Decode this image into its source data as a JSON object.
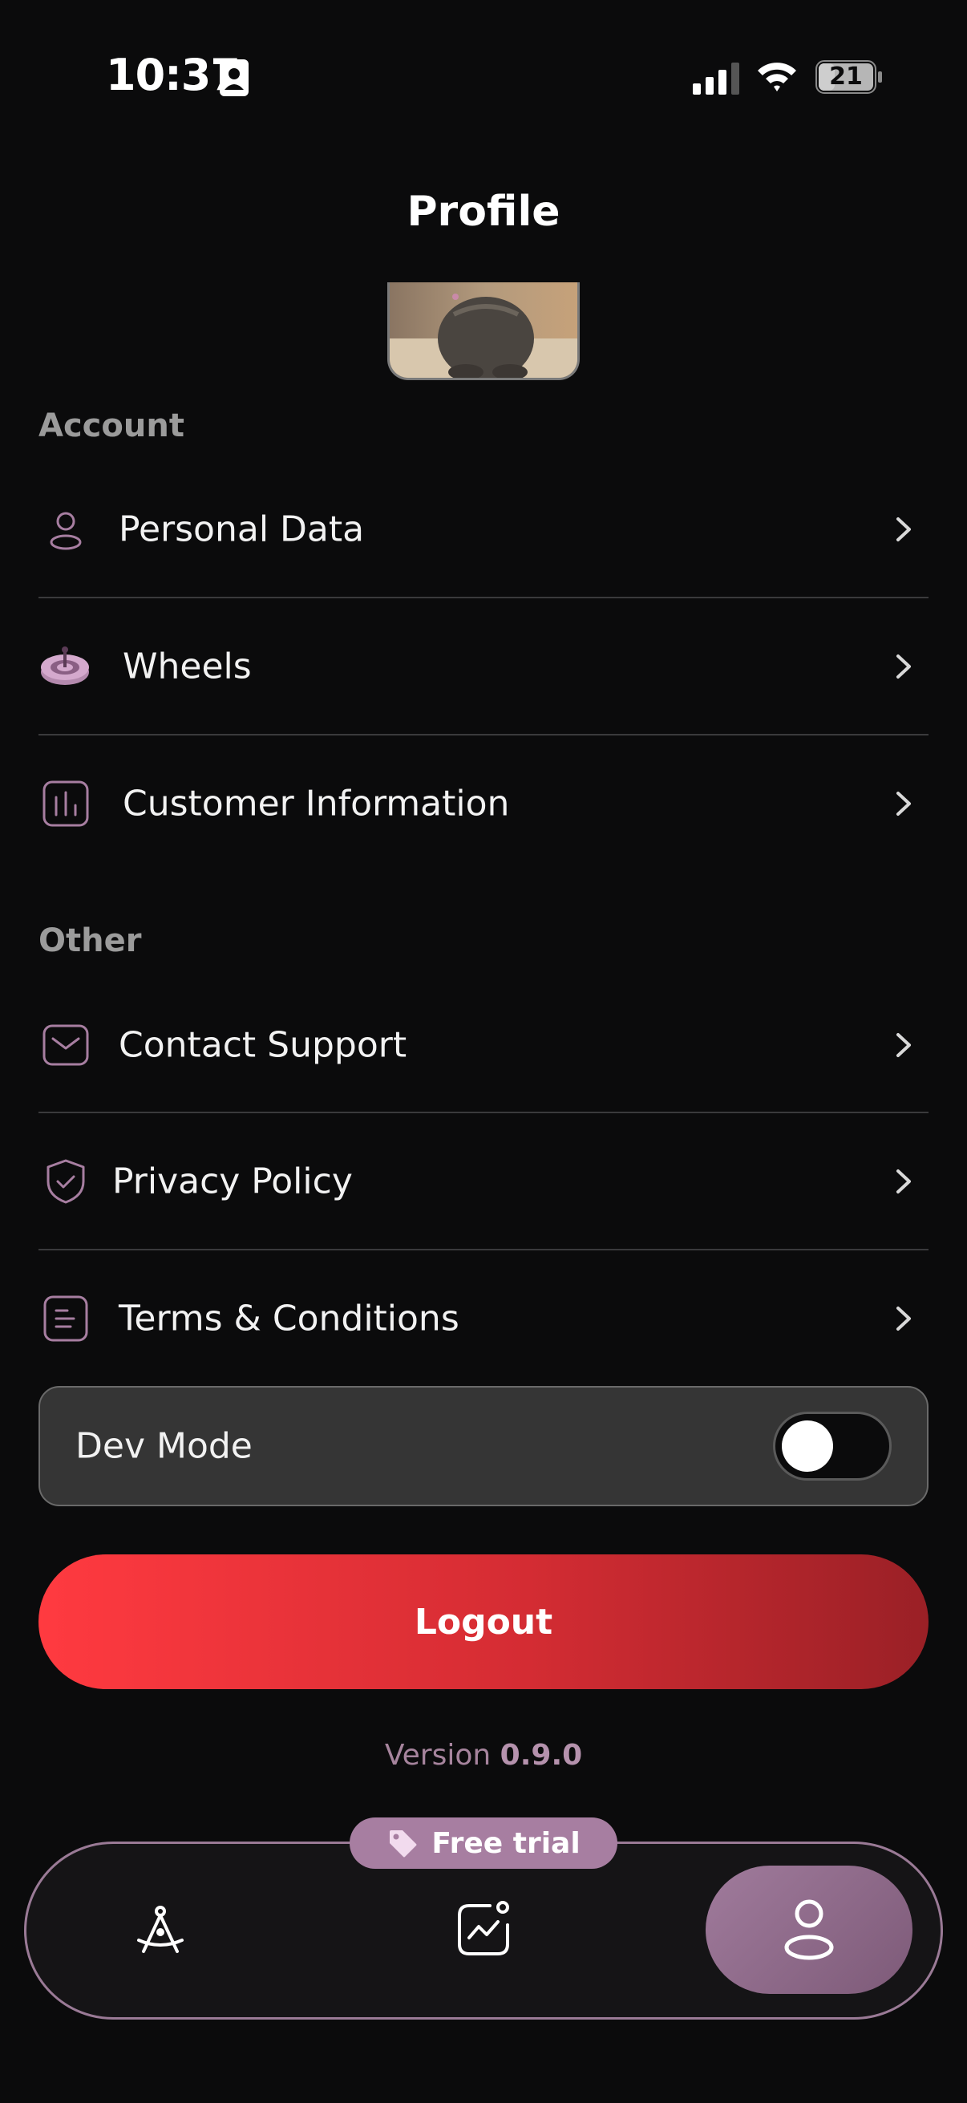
{
  "status_bar": {
    "time": "10:37",
    "battery": "21"
  },
  "header": {
    "title": "Profile"
  },
  "account": {
    "title": "Account",
    "items": [
      {
        "label": "Personal Data",
        "icon": "person-icon"
      },
      {
        "label": "Wheels",
        "icon": "wheel-icon"
      },
      {
        "label": "Customer Information",
        "icon": "bar-chart-icon"
      }
    ]
  },
  "other": {
    "title": "Other",
    "items": [
      {
        "label": "Contact Support",
        "icon": "mail-icon"
      },
      {
        "label": "Privacy Policy",
        "icon": "shield-check-icon"
      },
      {
        "label": "Terms & Conditions",
        "icon": "document-icon"
      }
    ]
  },
  "dev_mode": {
    "label": "Dev Mode",
    "enabled": false
  },
  "logout": {
    "label": "Logout"
  },
  "version": {
    "prefix": "Version",
    "number": "0.9.0"
  },
  "nav": {
    "badge": "Free trial",
    "items": [
      {
        "icon": "compass-icon",
        "active": false
      },
      {
        "icon": "stats-icon",
        "active": false
      },
      {
        "icon": "profile-icon",
        "active": true
      }
    ]
  },
  "colors": {
    "accent": "#a77ea1",
    "logout_start": "#ff3a40",
    "logout_end": "#9a2026",
    "background": "#0b0b0c"
  }
}
